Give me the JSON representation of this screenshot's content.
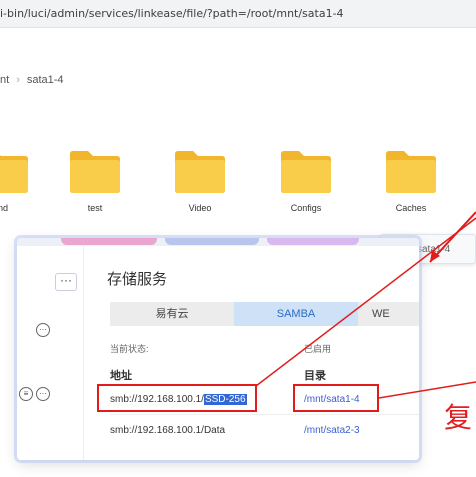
{
  "url": "i-bin/luci/admin/services/linkease/file/?path=/root/mnt/sata1-4",
  "breadcrumb": {
    "parent": "nt",
    "current": "sata1-4"
  },
  "folders": [
    {
      "name": "nd"
    },
    {
      "name": "test"
    },
    {
      "name": "Video"
    },
    {
      "name": "Configs"
    },
    {
      "name": "Caches"
    }
  ],
  "popup": {
    "label": "sata1-4"
  },
  "dialog": {
    "title": "存储服务",
    "tabs": [
      "易有云",
      "SAMBA",
      "WE"
    ],
    "status_label": "当前状态:",
    "status_value": "已启用",
    "col_address": "地址",
    "col_dir": "目录",
    "rows": [
      {
        "addr_prefix": "smb://192.168.100.1/",
        "addr_selected": "SSD-256",
        "dir": "/mnt/sata1-4"
      },
      {
        "addr_prefix": "smb://192.168.100.1/Data",
        "addr_selected": "",
        "dir": "/mnt/sata2-3"
      }
    ],
    "more_label": "···"
  },
  "annotation": {
    "text": "复"
  },
  "colors": {
    "accent": "#2b6cc4",
    "folder": "#f7c948",
    "highlight": "#3268d6",
    "annotation_red": "#e21b1b"
  },
  "icons": [
    "more-icon",
    "ellipsis-circle-icon",
    "list-circle-icon",
    "folder-icon",
    "chevron-right-icon"
  ]
}
